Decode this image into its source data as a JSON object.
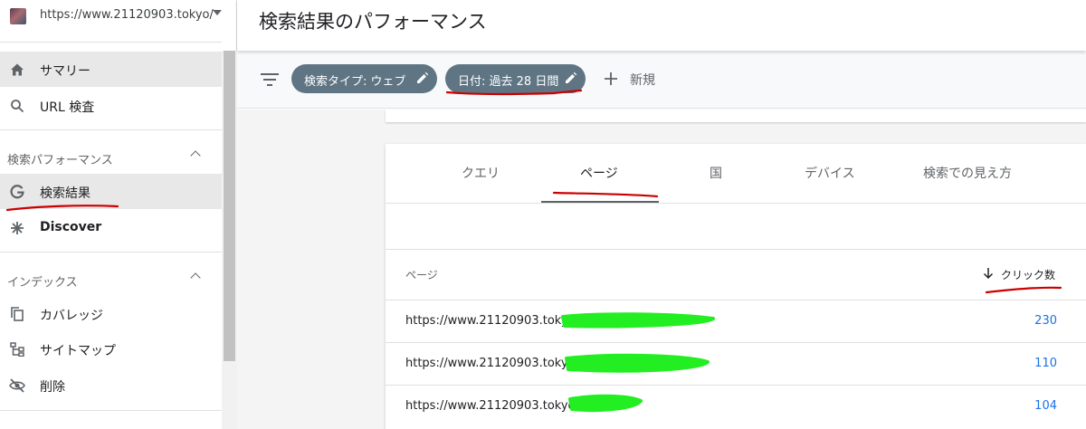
{
  "property": {
    "url": "https://www.21120903.tokyo/"
  },
  "sidebar": {
    "nav_top": [
      {
        "label": "サマリー",
        "icon": "home-icon"
      },
      {
        "label": "URL 検査",
        "icon": "search-icon"
      }
    ],
    "section_performance": "検索パフォーマンス",
    "nav_performance": [
      {
        "label": "検索結果",
        "icon": "google-g-icon"
      },
      {
        "label": "Discover",
        "icon": "asterisk-icon"
      }
    ],
    "section_index": "インデックス",
    "nav_index": [
      {
        "label": "カバレッジ",
        "icon": "copy-icon"
      },
      {
        "label": "サイトマップ",
        "icon": "sitemap-icon"
      },
      {
        "label": "削除",
        "icon": "eye-off-icon"
      }
    ]
  },
  "header": {
    "title": "検索結果のパフォーマンス"
  },
  "filters": {
    "chips": [
      "検索タイプ: ウェブ",
      "日付: 過去 28 日間"
    ],
    "new_label": "新規",
    "chip_color": "#5f7584"
  },
  "tabs": [
    "クエリ",
    "ページ",
    "国",
    "デバイス",
    "検索での見え方"
  ],
  "active_tab": "ページ",
  "table": {
    "col_page": "ページ",
    "col_clicks": "クリック数",
    "rows": [
      {
        "url": "https://www.21120903.toky",
        "clicks": "230"
      },
      {
        "url": "https://www.21120903.toky",
        "clicks": "110"
      },
      {
        "url": "https://www.21120903.tokyo",
        "clicks": "104"
      }
    ]
  },
  "colors": {
    "annotation_red": "#cc0000",
    "redaction_green": "#22ee22",
    "link_blue": "#1a73e8"
  }
}
